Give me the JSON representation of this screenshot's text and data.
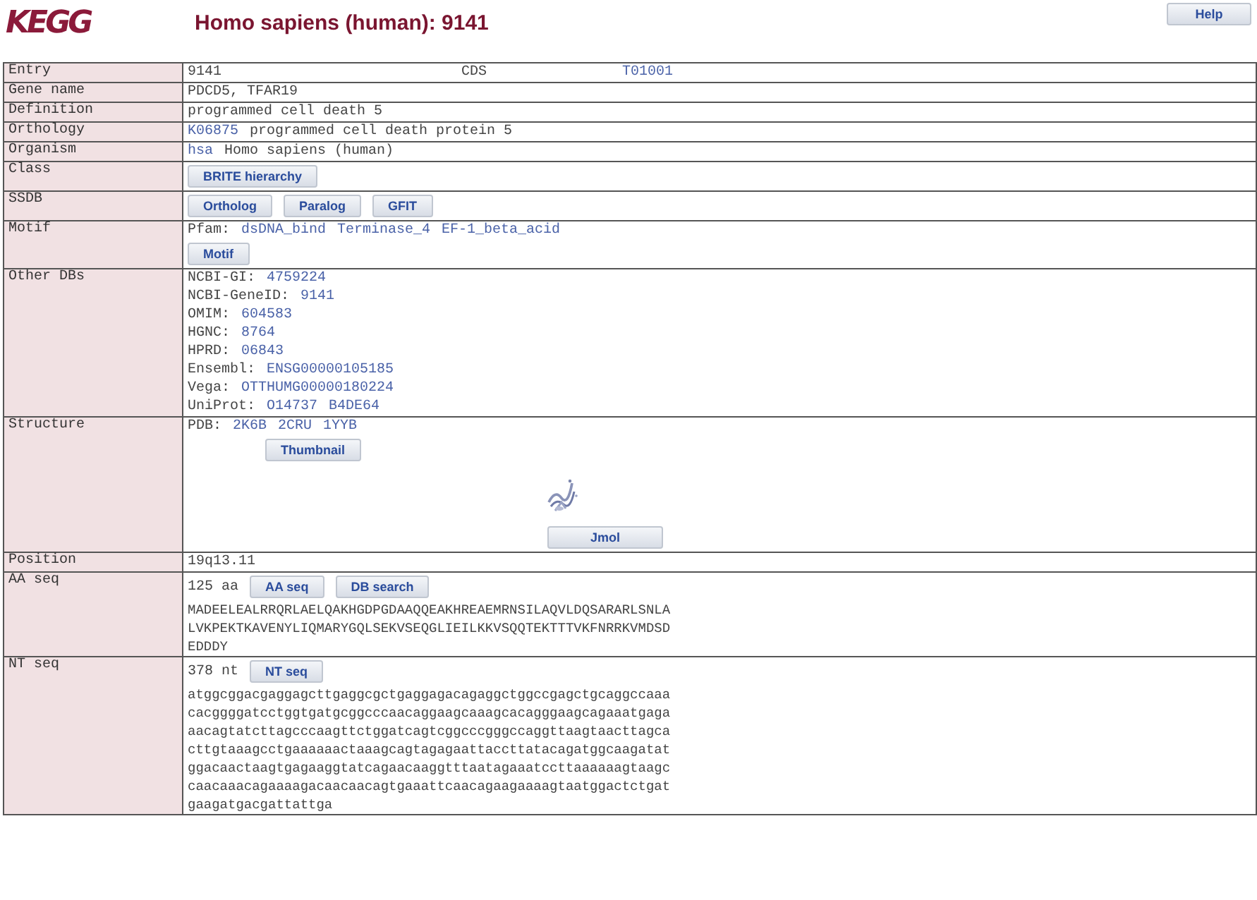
{
  "header": {
    "logo": "KEGG",
    "title": "Homo sapiens (human): 9141",
    "help_button": "Help"
  },
  "rows": [
    {
      "label": "Entry",
      "kind": "fields",
      "lines": [
        [
          {
            "kind": "text",
            "text": "9141"
          },
          {
            "kind": "text",
            "text": "CDS"
          },
          {
            "kind": "link",
            "text": "T01001"
          }
        ]
      ]
    },
    {
      "label": "Gene name",
      "kind": "lines",
      "lines": [
        [
          {
            "kind": "text",
            "text": "PDCD5, TFAR19"
          }
        ]
      ]
    },
    {
      "label": "Definition",
      "kind": "lines",
      "lines": [
        [
          {
            "kind": "text",
            "text": "programmed cell death 5"
          }
        ]
      ]
    },
    {
      "label": "Orthology",
      "kind": "lines",
      "lines": [
        [
          {
            "kind": "link",
            "text": "K06875"
          },
          {
            "kind": "text",
            "text": "programmed cell death protein 5"
          }
        ]
      ]
    },
    {
      "label": "Organism",
      "kind": "lines",
      "lines": [
        [
          {
            "kind": "link",
            "text": "hsa"
          },
          {
            "kind": "text",
            "text": "Homo sapiens (human)"
          }
        ]
      ]
    },
    {
      "label": "Class",
      "kind": "lines",
      "lines": [
        [
          {
            "kind": "button",
            "text": "BRITE hierarchy"
          }
        ]
      ]
    },
    {
      "label": "SSDB",
      "kind": "lines",
      "lines": [
        [
          {
            "kind": "button",
            "text": "Ortholog"
          },
          {
            "kind": "button",
            "text": "Paralog"
          },
          {
            "kind": "button",
            "text": "GFIT"
          }
        ]
      ]
    },
    {
      "label": "Motif",
      "kind": "lines",
      "lines": [
        [
          {
            "kind": "text",
            "text": "Pfam:"
          },
          {
            "kind": "link",
            "text": "dsDNA_bind"
          },
          {
            "kind": "link",
            "text": "Terminase_4"
          },
          {
            "kind": "link",
            "text": "EF-1_beta_acid"
          }
        ],
        [
          {
            "kind": "button",
            "text": "Motif"
          }
        ]
      ]
    },
    {
      "label": "Other DBs",
      "kind": "lines",
      "lines": [
        [
          {
            "kind": "text",
            "text": "NCBI-GI:"
          },
          {
            "kind": "link",
            "text": "4759224"
          }
        ],
        [
          {
            "kind": "text",
            "text": "NCBI-GeneID:"
          },
          {
            "kind": "link",
            "text": "9141"
          }
        ],
        [
          {
            "kind": "text",
            "text": "OMIM:"
          },
          {
            "kind": "link",
            "text": "604583"
          }
        ],
        [
          {
            "kind": "text",
            "text": "HGNC:"
          },
          {
            "kind": "link",
            "text": "8764"
          }
        ],
        [
          {
            "kind": "text",
            "text": "HPRD:"
          },
          {
            "kind": "link",
            "text": "06843"
          }
        ],
        [
          {
            "kind": "text",
            "text": "Ensembl:"
          },
          {
            "kind": "link",
            "text": "ENSG00000105185"
          }
        ],
        [
          {
            "kind": "text",
            "text": "Vega:"
          },
          {
            "kind": "link",
            "text": "OTTHUMG00000180224"
          }
        ],
        [
          {
            "kind": "text",
            "text": "UniProt:"
          },
          {
            "kind": "link",
            "text": "O14737"
          },
          {
            "kind": "link",
            "text": "B4DE64"
          }
        ]
      ]
    },
    {
      "label": "Structure",
      "kind": "structure",
      "lines": [
        [
          {
            "kind": "text",
            "text": "PDB:"
          },
          {
            "kind": "link",
            "text": "2K6B"
          },
          {
            "kind": "link",
            "text": "2CRU"
          },
          {
            "kind": "link",
            "text": "1YYB"
          }
        ],
        [
          {
            "kind": "button",
            "text": "Thumbnail"
          }
        ],
        [
          {
            "kind": "picture"
          }
        ],
        [
          {
            "kind": "button",
            "text": "Jmol"
          }
        ]
      ]
    },
    {
      "label": "Position",
      "kind": "lines",
      "lines": [
        [
          {
            "kind": "text",
            "text": "19q13.11"
          }
        ]
      ]
    },
    {
      "label": "AA seq",
      "kind": "lines",
      "lines": [
        [
          {
            "kind": "text",
            "text": "125 aa"
          },
          {
            "kind": "button",
            "text": "AA seq"
          },
          {
            "kind": "button",
            "text": "DB search"
          }
        ],
        [
          {
            "kind": "seq",
            "text": "MADEELEALRRQRLAELQAKHGDPGDAAQQEAKHREAEMRNSILAQVLDQSARARLSNLA"
          }
        ],
        [
          {
            "kind": "seq",
            "text": "LVKPEKTKAVENYLIQMARYGQLSEKVSEQGLIEILKKVSQQTEKTTTVKFNRRKVMDSD"
          }
        ],
        [
          {
            "kind": "seq",
            "text": "EDDDY"
          }
        ]
      ]
    },
    {
      "label": "NT seq",
      "kind": "lines",
      "lines": [
        [
          {
            "kind": "text",
            "text": "378 nt"
          },
          {
            "kind": "button",
            "text": "NT seq"
          }
        ],
        [
          {
            "kind": "seq",
            "text": "atggcggacgaggagcttgaggcgctgaggagacagaggctggccgagctgcaggccaaa"
          }
        ],
        [
          {
            "kind": "seq",
            "text": "cacggggatcctggtgatgcggcccaacaggaagcaaagcacagggaagcagaaatgaga"
          }
        ],
        [
          {
            "kind": "seq",
            "text": "aacagtatcttagcccaagttctggatcagtcggcccgggccaggttaagtaacttagca"
          }
        ],
        [
          {
            "kind": "seq",
            "text": "cttgtaaagcctgaaaaaactaaagcagtagagaattaccttatacagatggcaagatat"
          }
        ],
        [
          {
            "kind": "seq",
            "text": "ggacaactaagtgagaaggtatcagaacaaggtttaatagaaatccttaaaaaagtaagc"
          }
        ],
        [
          {
            "kind": "seq",
            "text": "caacaaacagaaaagacaacaacagtgaaattcaacagaagaaaagtaatggactctgat"
          }
        ],
        [
          {
            "kind": "seq",
            "text": "gaagatgacgattattga"
          }
        ]
      ]
    }
  ]
}
